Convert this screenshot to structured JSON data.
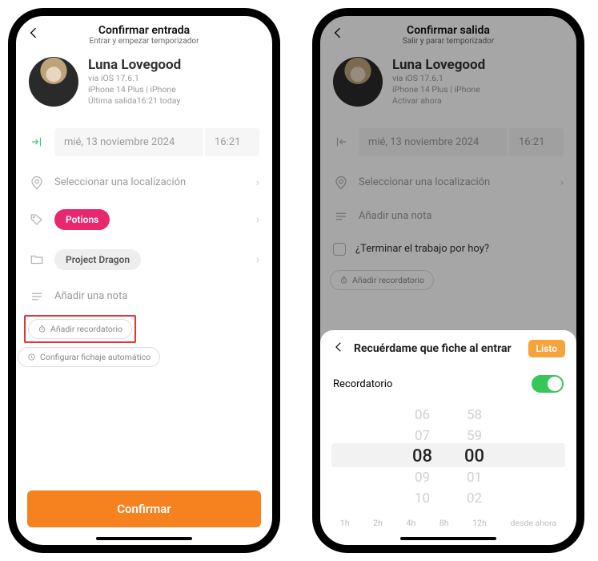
{
  "colors": {
    "accent": "#f5821f",
    "pink": "#e8276f",
    "success": "#35c759"
  },
  "left": {
    "header": {
      "title": "Confirmar entrada",
      "subtitle": "Entrar y empezar temporizador"
    },
    "profile": {
      "name": "Luna Lovegood",
      "meta1": "vía iOS 17.6.1",
      "meta2": "iPhone 14 Plus | iPhone",
      "meta3": "Última salida16:21 today"
    },
    "date": "mié, 13 noviembre 2024",
    "time": "16:21",
    "location_placeholder": "Seleccionar una localización",
    "tag_label": "Potions",
    "project_label": "Project Dragon",
    "note_placeholder": "Añadir una nota",
    "chip_reminder": "Añadir recordatorio",
    "chip_auto": "Configurar fichaje automático",
    "confirm": "Confirmar"
  },
  "right": {
    "header": {
      "title": "Confirmar salida",
      "subtitle": "Salir y parar temporizador"
    },
    "profile": {
      "name": "Luna Lovegood",
      "meta1": "vía iOS 17.6.1",
      "meta2": "iPhone 14 Plus | iPhone",
      "meta3": "Activar ahora"
    },
    "date": "mié, 13 noviembre 2024",
    "time": "16:21",
    "location_placeholder": "Seleccionar una localización",
    "note_placeholder": "Añadir una nota",
    "finish_question": "¿Terminar el trabajo por hoy?",
    "chip_reminder": "Añadir recordatorio",
    "sheet": {
      "title": "Recuérdame que fiche al entrar",
      "done": "Listo",
      "toggle_label": "Recordatorio",
      "toggle_on": true,
      "picker_hours": [
        "06",
        "07",
        "08",
        "09",
        "10"
      ],
      "picker_mins": [
        "58",
        "59",
        "00",
        "01",
        "02"
      ],
      "picker_selected_index": 2,
      "presets": [
        "1h",
        "2h",
        "4h",
        "8h",
        "12h",
        "desde ahora"
      ]
    }
  }
}
